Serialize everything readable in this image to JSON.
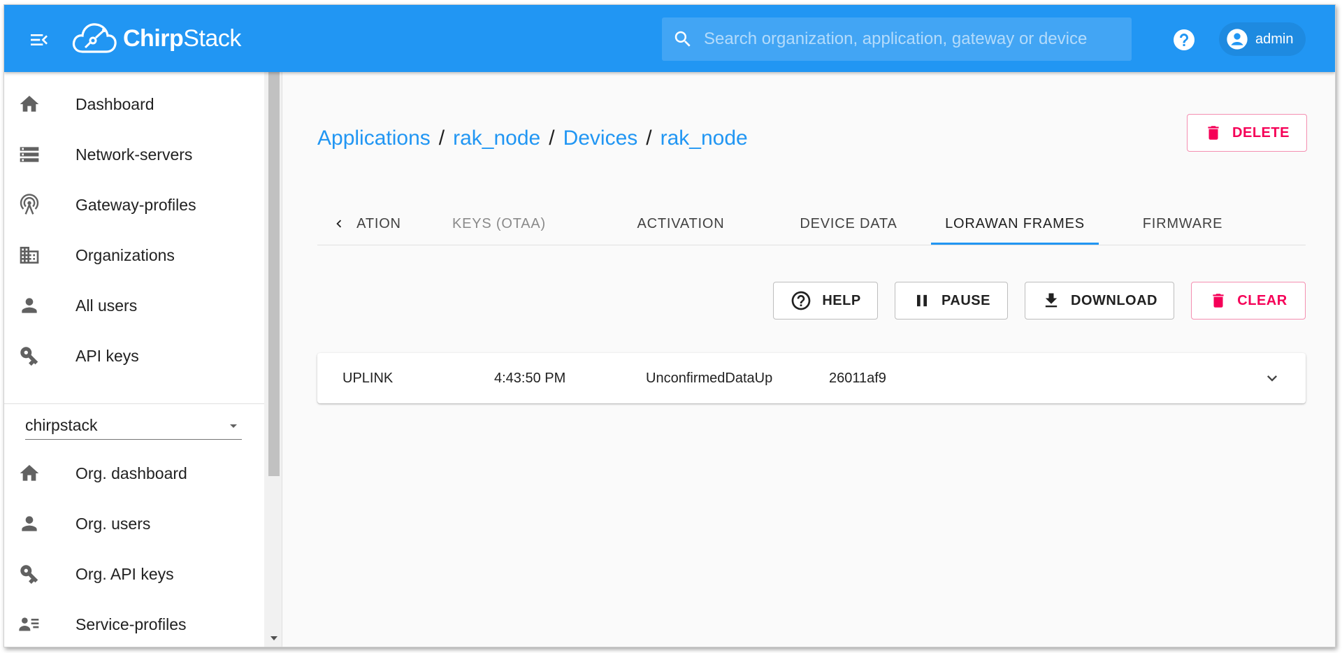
{
  "header": {
    "brand_bold": "Chirp",
    "brand_light": "Stack",
    "search_placeholder": "Search organization, application, gateway or device",
    "user": "admin",
    "color": "#2196f3"
  },
  "sidebar": {
    "items": [
      {
        "label": "Dashboard",
        "icon": "home-icon"
      },
      {
        "label": "Network-servers",
        "icon": "server-icon"
      },
      {
        "label": "Gateway-profiles",
        "icon": "antenna-icon"
      },
      {
        "label": "Organizations",
        "icon": "building-icon"
      },
      {
        "label": "All users",
        "icon": "user-icon"
      },
      {
        "label": "API keys",
        "icon": "key-icon"
      }
    ],
    "org_select": "chirpstack",
    "org_items": [
      {
        "label": "Org. dashboard",
        "icon": "home-icon"
      },
      {
        "label": "Org. users",
        "icon": "user-icon"
      },
      {
        "label": "Org. API keys",
        "icon": "key-icon"
      },
      {
        "label": "Service-profiles",
        "icon": "profile-list-icon"
      }
    ]
  },
  "breadcrumb": [
    "Applications",
    "rak_node",
    "Devices",
    "rak_node"
  ],
  "delete_label": "DELETE",
  "tabs": [
    "ATION",
    "KEYS (OTAA)",
    "ACTIVATION",
    "DEVICE DATA",
    "LORAWAN FRAMES",
    "FIRMWARE"
  ],
  "active_tab": "LORAWAN FRAMES",
  "actions": {
    "help": "HELP",
    "pause": "PAUSE",
    "download": "DOWNLOAD",
    "clear": "CLEAR"
  },
  "frames": [
    {
      "direction": "UPLINK",
      "time": "4:43:50 PM",
      "mtype": "UnconfirmedDataUp",
      "dev_addr": "26011af9"
    }
  ],
  "colors": {
    "primary": "#2196f3",
    "danger": "#f50057"
  }
}
